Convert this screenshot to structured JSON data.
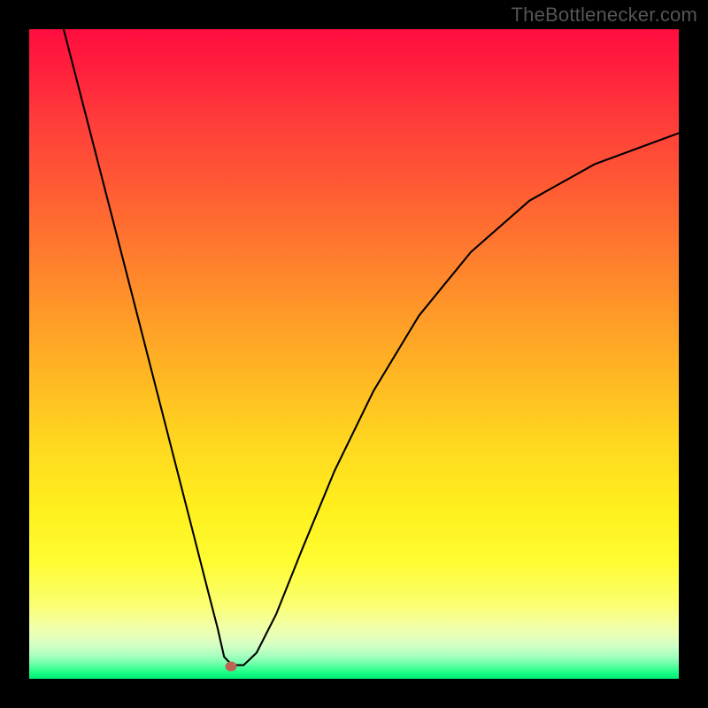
{
  "watermark": "TheBottlenecker.com",
  "chart_data": {
    "type": "line",
    "title": "",
    "xlabel": "",
    "ylabel": "",
    "xlim": [
      0,
      1
    ],
    "ylim": [
      0,
      1
    ],
    "series": [
      {
        "name": "curve",
        "x": [
          0.053,
          0.1,
          0.15,
          0.2,
          0.25,
          0.275,
          0.29,
          0.3,
          0.312,
          0.33,
          0.35,
          0.38,
          0.42,
          0.47,
          0.53,
          0.6,
          0.68,
          0.77,
          0.87,
          1.0
        ],
        "y": [
          1.0,
          0.818,
          0.624,
          0.429,
          0.234,
          0.136,
          0.078,
          0.034,
          0.021,
          0.021,
          0.04,
          0.099,
          0.199,
          0.32,
          0.443,
          0.559,
          0.657,
          0.736,
          0.792,
          0.84
        ]
      }
    ],
    "marker": {
      "x": 0.31,
      "y": 0.019
    },
    "notes": "Axes have no tick labels; y increases upward; values estimated from pixel positions."
  }
}
